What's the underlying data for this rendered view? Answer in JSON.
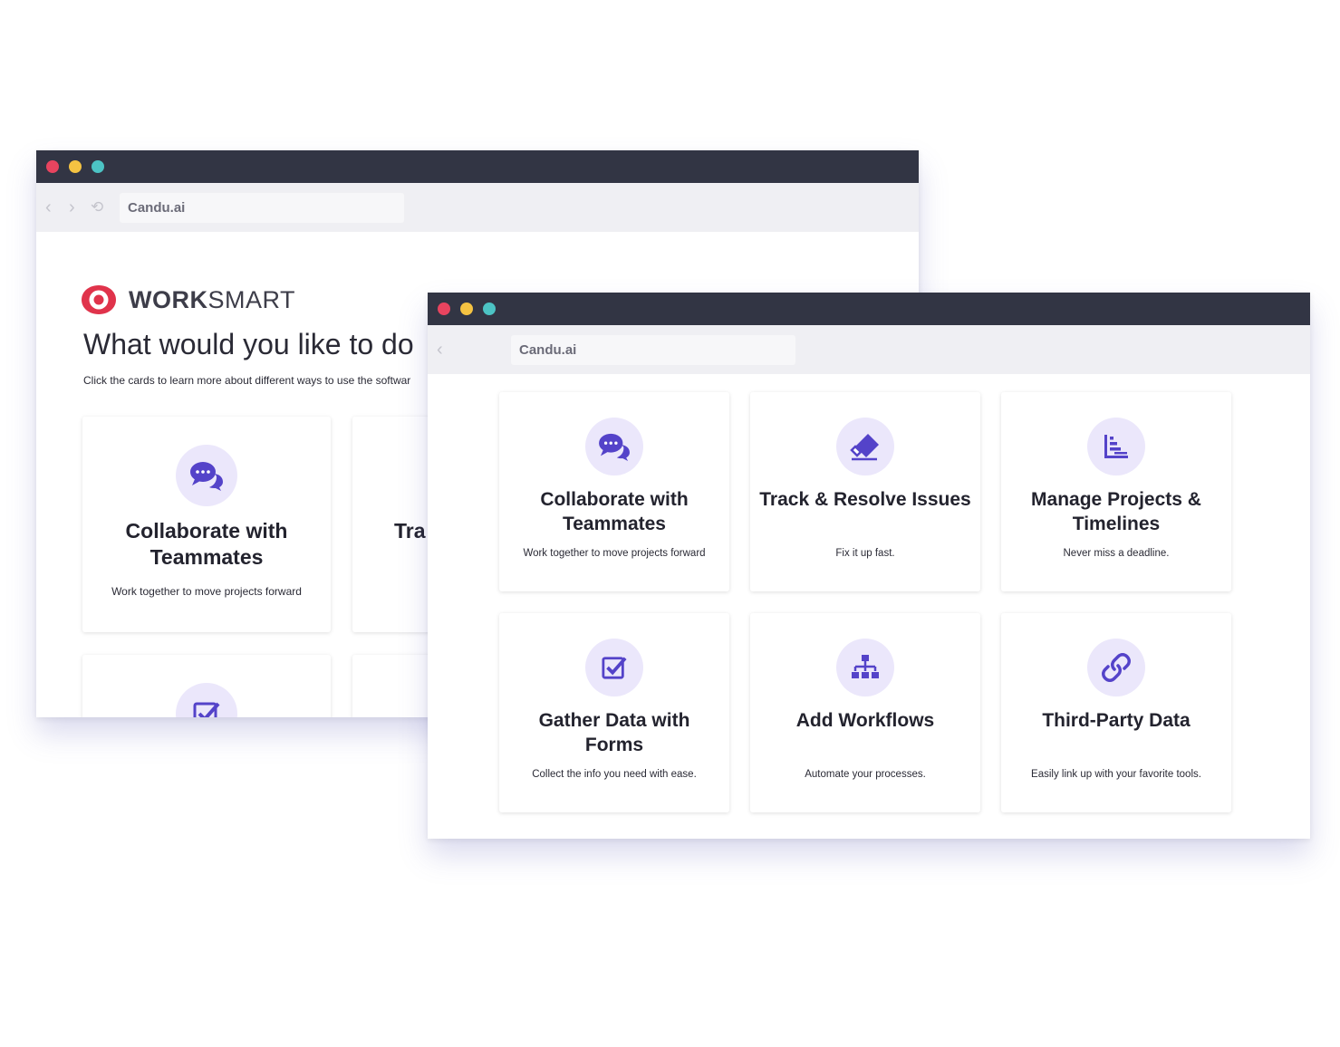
{
  "back_window": {
    "address": "Candu.ai",
    "brand_bold": "WORK",
    "brand_light": "SMART",
    "headline": "What would you like to do",
    "subline": "Click the cards to learn more about different ways to use the softwar",
    "cards": [
      {
        "title": "Collaborate with Teammates",
        "desc": "Work together to move projects forward",
        "icon": "chat-icon"
      },
      {
        "title": "Tra",
        "desc": "",
        "icon": ""
      }
    ]
  },
  "front_window": {
    "address": "Candu.ai",
    "cards": [
      {
        "title": "Collaborate with Teammates",
        "desc": "Work together to move projects forward",
        "icon": "chat-icon"
      },
      {
        "title": "Track & Resolve Issues",
        "desc": "Fix it up fast.",
        "icon": "eraser-icon"
      },
      {
        "title": "Manage Projects & Timelines",
        "desc": "Never miss a deadline.",
        "icon": "timeline-chart-icon"
      },
      {
        "title": "Gather Data with Forms",
        "desc": "Collect the info you need with ease.",
        "icon": "checkbox-icon"
      },
      {
        "title": "Add Workflows",
        "desc": "Automate your processes.",
        "icon": "workflow-icon"
      },
      {
        "title": "Third-Party Data",
        "desc": "Easily link up with your favorite tools.",
        "icon": "link-icon"
      }
    ]
  },
  "colors": {
    "titlebar": "#323544",
    "dot_red": "#e8445f",
    "dot_yellow": "#f5c342",
    "dot_green": "#4cc3c4",
    "accent_purple": "#5443c9",
    "icon_bg": "#ebe7fb",
    "brand_red": "#e0334b"
  }
}
